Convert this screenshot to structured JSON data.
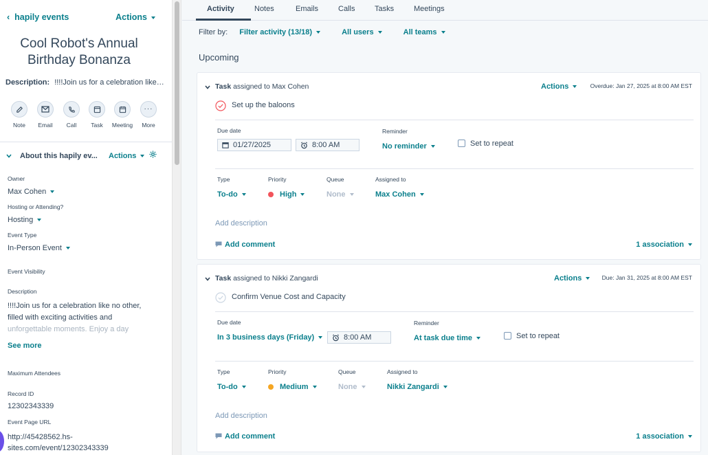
{
  "sidebar": {
    "back_label": "hapily events",
    "actions_label": "Actions",
    "record_title_line1": "Cool Robot's Annual",
    "record_title_line2": "Birthday Bonanza",
    "description_label": "Description:",
    "description_preview": "!!!!Join us for a celebration like…",
    "quick_actions": [
      {
        "label": "Note",
        "icon": "note-icon"
      },
      {
        "label": "Email",
        "icon": "email-icon"
      },
      {
        "label": "Call",
        "icon": "call-icon"
      },
      {
        "label": "Task",
        "icon": "task-icon"
      },
      {
        "label": "Meeting",
        "icon": "meeting-icon"
      },
      {
        "label": "More",
        "icon": "more-icon"
      }
    ],
    "about_title": "About this hapily ev...",
    "about_actions": "Actions",
    "properties": {
      "owner_label": "Owner",
      "owner_value": "Max Cohen",
      "hosting_label": "Hosting or Attending?",
      "hosting_value": "Hosting",
      "event_type_label": "Event Type",
      "event_type_value": "In-Person Event",
      "event_visibility_label": "Event Visibility",
      "description_label": "Description",
      "description_line1": "!!!!Join us for a celebration like no other,",
      "description_line2": "filled with exciting activities and",
      "description_line3": "unforgettable moments. Enjoy a day",
      "see_more": "See more",
      "max_attendees_label": "Maximum Attendees",
      "record_id_label": "Record ID",
      "record_id_value": "12302343339",
      "event_url_label": "Event Page URL",
      "event_url_line1": "http://45428562.hs-",
      "event_url_line2": "sites.com/event/12302343339"
    }
  },
  "tabs": [
    "Activity",
    "Notes",
    "Emails",
    "Calls",
    "Tasks",
    "Meetings"
  ],
  "active_tab": "Activity",
  "filters": {
    "label": "Filter by:",
    "activity": "Filter activity (13/18)",
    "users": "All users",
    "teams": "All teams"
  },
  "section_title": "Upcoming",
  "tasks": [
    {
      "type_word": "Task",
      "assigned_text": "assigned to Max Cohen",
      "actions_label": "Actions",
      "due_note": "Overdue: Jan 27, 2025 at 8:00 AM EST",
      "title": "Set up the baloons",
      "due_date_label": "Due date",
      "due_date_value": "01/27/2025",
      "time_value": "8:00 AM",
      "reminder_label": "Reminder",
      "reminder_value": "No reminder",
      "repeat_label": "Set to repeat",
      "type_label": "Type",
      "type_value": "To-do",
      "priority_label": "Priority",
      "priority_value": "High",
      "priority_color": "#f2545b",
      "queue_label": "Queue",
      "queue_value": "None",
      "assigned_label": "Assigned to",
      "assigned_value": "Max Cohen",
      "add_description": "Add description",
      "add_comment": "Add comment",
      "associations": "1 association"
    },
    {
      "type_word": "Task",
      "assigned_text": "assigned to Nikki Zangardi",
      "actions_label": "Actions",
      "due_note": "Due: Jan 31, 2025 at 8:00 AM EST",
      "title": "Confirm Venue Cost and Capacity",
      "due_date_label": "Due date",
      "due_date_value": "In 3 business days (Friday)",
      "time_value": "8:00 AM",
      "reminder_label": "Reminder",
      "reminder_value": "At task due time",
      "repeat_label": "Set to repeat",
      "type_label": "Type",
      "type_value": "To-do",
      "priority_label": "Priority",
      "priority_value": "Medium",
      "priority_color": "#f5a623",
      "queue_label": "Queue",
      "queue_value": "None",
      "assigned_label": "Assigned to",
      "assigned_value": "Nikki Zangardi",
      "add_description": "Add description",
      "add_comment": "Add comment",
      "associations": "1 association"
    }
  ]
}
